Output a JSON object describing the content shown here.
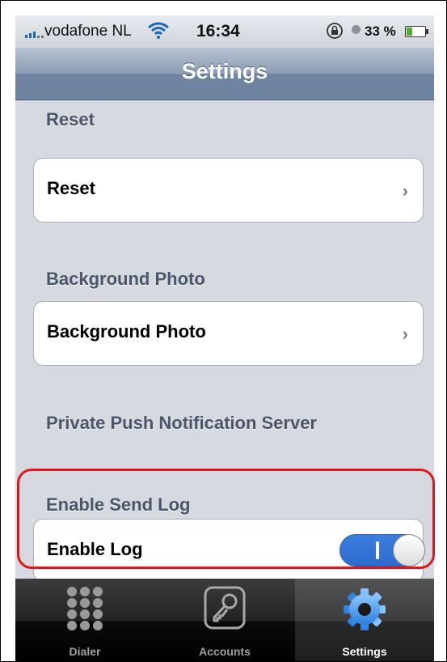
{
  "status_bar": {
    "carrier": "vodafone NL",
    "time": "16:34",
    "battery_percent": "33 %",
    "battery_level": 0.33,
    "icons": [
      "signal-icon",
      "wifi-icon",
      "rotation-lock-icon",
      "alarm-icon",
      "battery-icon"
    ]
  },
  "nav": {
    "title": "Settings"
  },
  "sections": {
    "reset_header": "Reset",
    "reset_cell": "Reset",
    "background_header": "Background Photo",
    "background_cell": "Background Photo",
    "push_header": "Private Push Notification Server",
    "sendlog_header": "Enable Send Log",
    "enable_log_cell": "Enable Log",
    "enable_log_on": true
  },
  "tabs": [
    {
      "label": "Dialer",
      "icon": "keypad-icon",
      "active": false
    },
    {
      "label": "Accounts",
      "icon": "key-icon",
      "active": false
    },
    {
      "label": "Settings",
      "icon": "gear-icon",
      "active": true
    }
  ],
  "colors": {
    "accent": "#2d6bcf",
    "highlight": "#e3141c"
  }
}
